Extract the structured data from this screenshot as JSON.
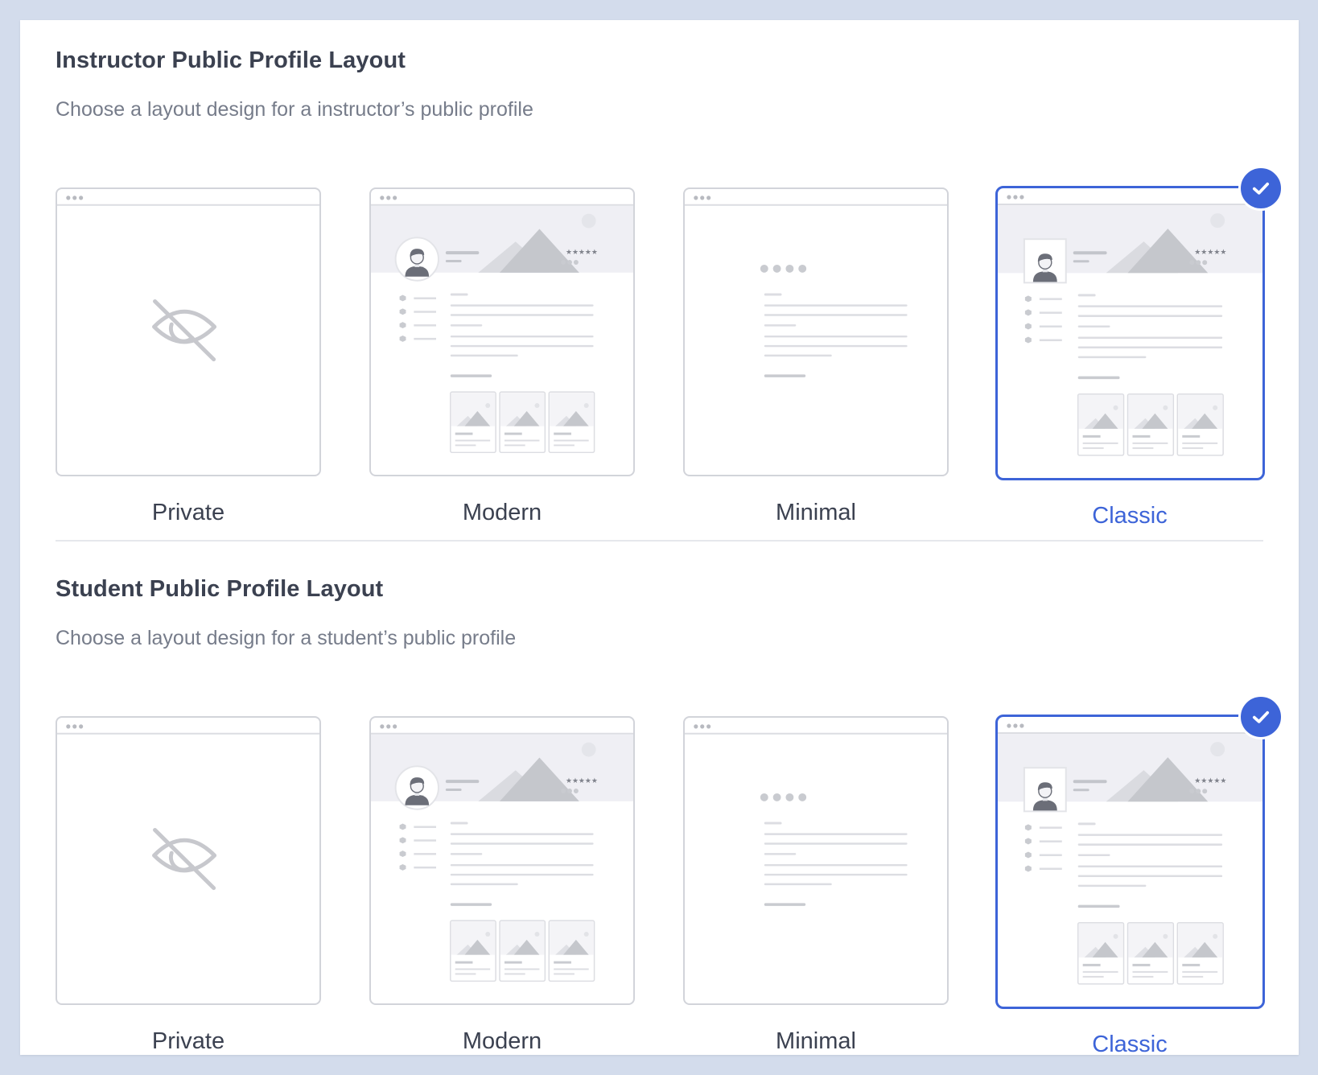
{
  "sections": [
    {
      "title": "Instructor Public Profile Layout",
      "subtitle": "Choose a layout design for a instructor’s public profile",
      "options": [
        {
          "label": "Private",
          "icon": "eye-slash-icon",
          "selected": false
        },
        {
          "label": "Modern",
          "selected": false
        },
        {
          "label": "Minimal",
          "selected": false
        },
        {
          "label": "Classic",
          "selected": true
        }
      ]
    },
    {
      "title": "Student Public Profile Layout",
      "subtitle": "Choose a layout design for a student’s public profile",
      "options": [
        {
          "label": "Private",
          "icon": "eye-slash-icon",
          "selected": false
        },
        {
          "label": "Modern",
          "selected": false
        },
        {
          "label": "Minimal",
          "selected": false
        },
        {
          "label": "Classic",
          "selected": true
        }
      ]
    }
  ],
  "colors": {
    "accent": "#3d64d8",
    "page_background": "#d3dcec",
    "text_primary": "#3b4150",
    "text_secondary": "#767c8a",
    "wireframe_line": "#d2d4da"
  }
}
